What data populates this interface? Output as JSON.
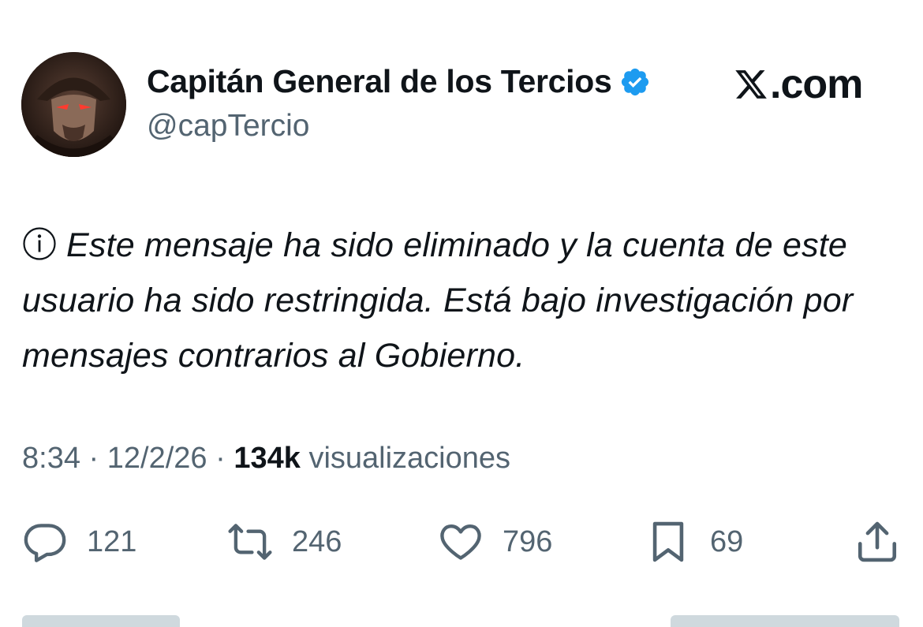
{
  "author": {
    "display_name": "Capitán General de los Tercios",
    "handle": "@capTercio",
    "verified": true,
    "avatar_icon": "hooded-masked-figure-avatar"
  },
  "brand": {
    "logo_text": ".com",
    "logo_icon": "x-logo-icon"
  },
  "post": {
    "info_icon": "info-circle-icon",
    "text": "Este mensaje ha sido eliminado y la cuenta de este usuario ha sido restringida. Está bajo investigación por mensajes contrarios al Gobierno."
  },
  "meta": {
    "time": "8:34",
    "separator": "·",
    "date": "12/2/26",
    "views_count": "134k",
    "views_label": "visualizaciones"
  },
  "actions": {
    "reply": {
      "icon": "reply-bubble-icon",
      "count": "121"
    },
    "repost": {
      "icon": "repost-icon",
      "count": "246"
    },
    "like": {
      "icon": "heart-icon",
      "count": "796"
    },
    "bookmark": {
      "icon": "bookmark-icon",
      "count": "69"
    },
    "share": {
      "icon": "share-upload-icon"
    }
  },
  "colors": {
    "text": "#0f1419",
    "secondary": "#536471",
    "verified_blue": "#1d9bf0"
  }
}
